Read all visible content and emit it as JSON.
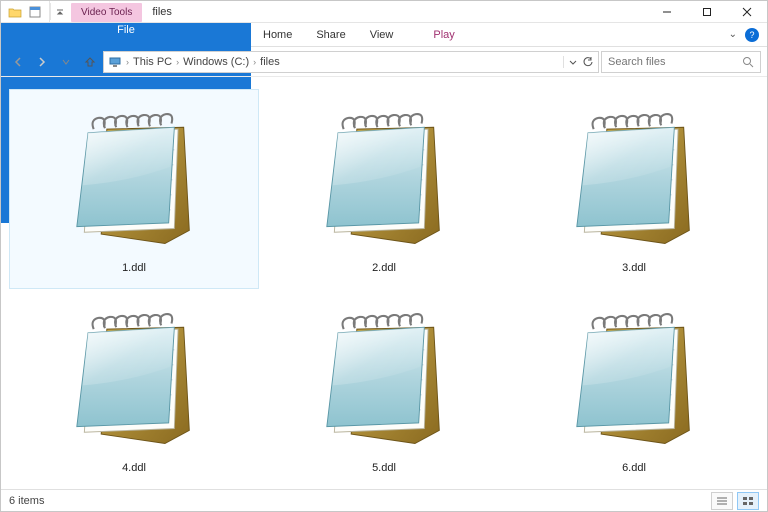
{
  "titlebar": {
    "context_tab": "Video Tools",
    "title": "files"
  },
  "tabs": {
    "file": "File",
    "home": "Home",
    "share": "Share",
    "view": "View",
    "play": "Play"
  },
  "breadcrumbs": [
    "This PC",
    "Windows (C:)",
    "files"
  ],
  "search": {
    "placeholder": "Search files"
  },
  "files": [
    {
      "name": "1.ddl",
      "selected": true
    },
    {
      "name": "2.ddl",
      "selected": false
    },
    {
      "name": "3.ddl",
      "selected": false
    },
    {
      "name": "4.ddl",
      "selected": false
    },
    {
      "name": "5.ddl",
      "selected": false
    },
    {
      "name": "6.ddl",
      "selected": false
    }
  ],
  "status": {
    "count_text": "6 items"
  }
}
